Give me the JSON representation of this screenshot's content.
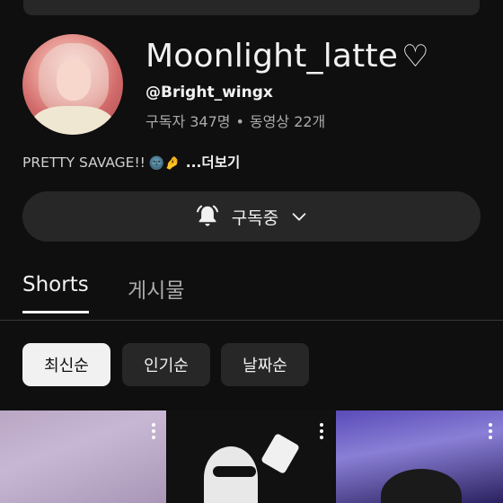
{
  "channel": {
    "name": "Moonlight_latte",
    "heart": "♡",
    "handle": "@Bright_wingx",
    "subscribers": "구독자 347명",
    "separator": "•",
    "videos": "동영상 22개",
    "description": "PRETTY SAVAGE!!",
    "description_emoji": "🌚🤌",
    "more_label": "...더보기"
  },
  "subscribe": {
    "label": "구독중",
    "icon": "bell-icon",
    "chevron": "chevron-down-icon"
  },
  "tabs": [
    {
      "label": "Shorts",
      "active": true
    },
    {
      "label": "게시물",
      "active": false
    }
  ],
  "sort_chips": [
    {
      "label": "최신순",
      "selected": true
    },
    {
      "label": "인기순",
      "selected": false
    },
    {
      "label": "날짜순",
      "selected": false
    }
  ],
  "colors": {
    "background": "#0f0f0f",
    "surface": "#272727",
    "text_primary": "#f1f1f1",
    "text_secondary": "#aaaaaa"
  }
}
